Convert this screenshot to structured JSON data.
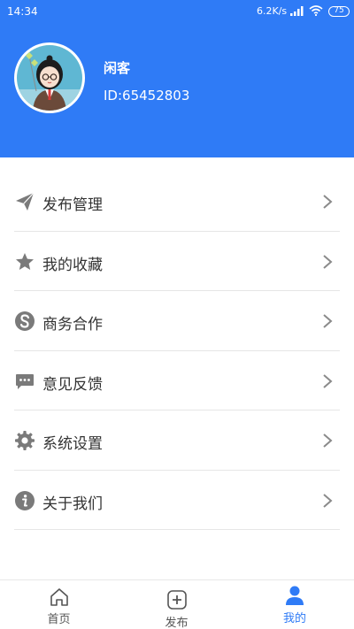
{
  "status_bar": {
    "time": "14:34",
    "network_speed": "6.2K/s",
    "battery": "75",
    "icons": [
      "signal-icon",
      "wifi-icon",
      "battery-icon"
    ]
  },
  "colors": {
    "brand": "#2f7bf6",
    "icon_gray": "#7a7a7a",
    "divider": "#e6e6e6"
  },
  "profile": {
    "name": "闲客",
    "id": "ID:65452803"
  },
  "menu": [
    {
      "label": "发布管理",
      "icon": "paper-plane-icon"
    },
    {
      "label": "我的收藏",
      "icon": "star-icon"
    },
    {
      "label": "商务合作",
      "icon": "s-circle-icon"
    },
    {
      "label": "意见反馈",
      "icon": "chat-bubble-icon"
    },
    {
      "label": "系统设置",
      "icon": "gear-icon"
    },
    {
      "label": "关于我们",
      "icon": "info-icon"
    }
  ],
  "tabbar": [
    {
      "label": "首页",
      "icon": "home-icon",
      "active": false
    },
    {
      "label": "发布",
      "icon": "plus-square-icon",
      "active": false
    },
    {
      "label": "我的",
      "icon": "person-icon",
      "active": true
    }
  ]
}
